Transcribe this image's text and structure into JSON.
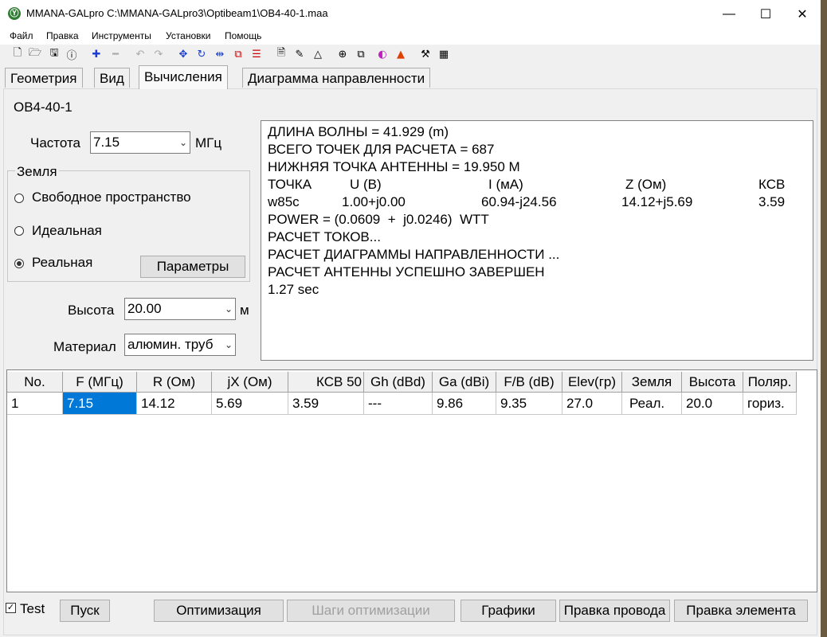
{
  "window": {
    "title": "MMANA-GALpro C:\\MMANA-GALpro3\\Optibeam1\\OB4-40-1.maa",
    "logo_glyph": "Ⓨ",
    "minimize": "—",
    "maximize": "☐",
    "close": "✕"
  },
  "menu": [
    "Файл",
    "Правка",
    "Инструменты",
    "Установки",
    "Помощь"
  ],
  "toolbar_icons": [
    "new-file-icon",
    "open-folder-icon",
    "save-icon",
    "info-icon",
    "plus-icon",
    "minus-icon",
    "undo-icon",
    "redo-icon",
    "move-icon",
    "rotate-icon",
    "mirror-icon",
    "copy-elements-icon",
    "align-icon",
    "text-file-icon",
    "edit-icon",
    "triangle-icon",
    "target-icon",
    "copy-icon",
    "rainbow-icon",
    "color-3d-icon",
    "tools-icon",
    "calculator-icon"
  ],
  "tabs": [
    {
      "label": "Геометрия",
      "active": false
    },
    {
      "label": "Вид",
      "active": false
    },
    {
      "label": "Вычисления",
      "active": true
    },
    {
      "label": "Диаграмма направленности",
      "active": false
    }
  ],
  "antenna_name": "OB4-40-1",
  "frequency": {
    "label": "Частота",
    "value": "7.15",
    "unit": "МГц"
  },
  "ground": {
    "title": "Земля",
    "options": [
      {
        "label": "Свободное пространство",
        "checked": false
      },
      {
        "label": "Идеальная",
        "checked": false
      },
      {
        "label": "Реальная",
        "checked": true
      }
    ],
    "params_button": "Параметры"
  },
  "height": {
    "label": "Высота",
    "value": "20.00",
    "unit": "м"
  },
  "material": {
    "label": "Материал",
    "value": "алюмин. труб"
  },
  "output_lines": [
    "ДЛИНА ВОЛНЫ = 41.929 (m)",
    "ВСЕГО ТОЧЕК ДЛЯ РАСЧЕТА = 687",
    "НИЖНЯЯ ТОЧКА АНТЕННЫ = 19.950 M",
    "POWER = (0.0609  +  j0.0246)  WTT",
    "РАСЧЕТ ТОКОВ...",
    "РАСЧЕТ ДИАГРАММЫ НАПРАВЛЕННОСТИ ...",
    "РАСЧЕТ АНТЕННЫ УСПЕШНО ЗАВЕРШЕН",
    "1.27 sec"
  ],
  "output_table": {
    "headers": [
      "ТОЧКА",
      "U (B)",
      "I (мА)",
      "Z (Ом)",
      "КСВ"
    ],
    "row": [
      "w85c",
      "1.00+j0.00",
      "60.94-j24.56",
      "14.12+j5.69",
      "3.59"
    ]
  },
  "results_grid": {
    "headers": [
      "No.",
      "F (МГц)",
      "R (Ом)",
      "jX (Ом)",
      "КСВ 50",
      "Gh (dBd)",
      "Ga (dBi)",
      "F/B (dB)",
      "Elev(гр)",
      "Земля",
      "Высота",
      "Поляр."
    ],
    "rows": [
      [
        "1",
        "7.15",
        "14.12",
        "5.69",
        "3.59",
        "---",
        "9.86",
        "9.35",
        "27.0",
        "Реал.",
        "20.0",
        "гориз."
      ]
    ]
  },
  "bottom": {
    "test_label": "Test",
    "test_checked": true,
    "buttons": [
      "Пуск",
      "Оптимизация",
      "Шаги оптимизации",
      "Графики",
      "Правка провода",
      "Правка элемента"
    ]
  },
  "colors": {
    "selection": "#0078d7",
    "disabled_text": "#a0a0a0"
  }
}
